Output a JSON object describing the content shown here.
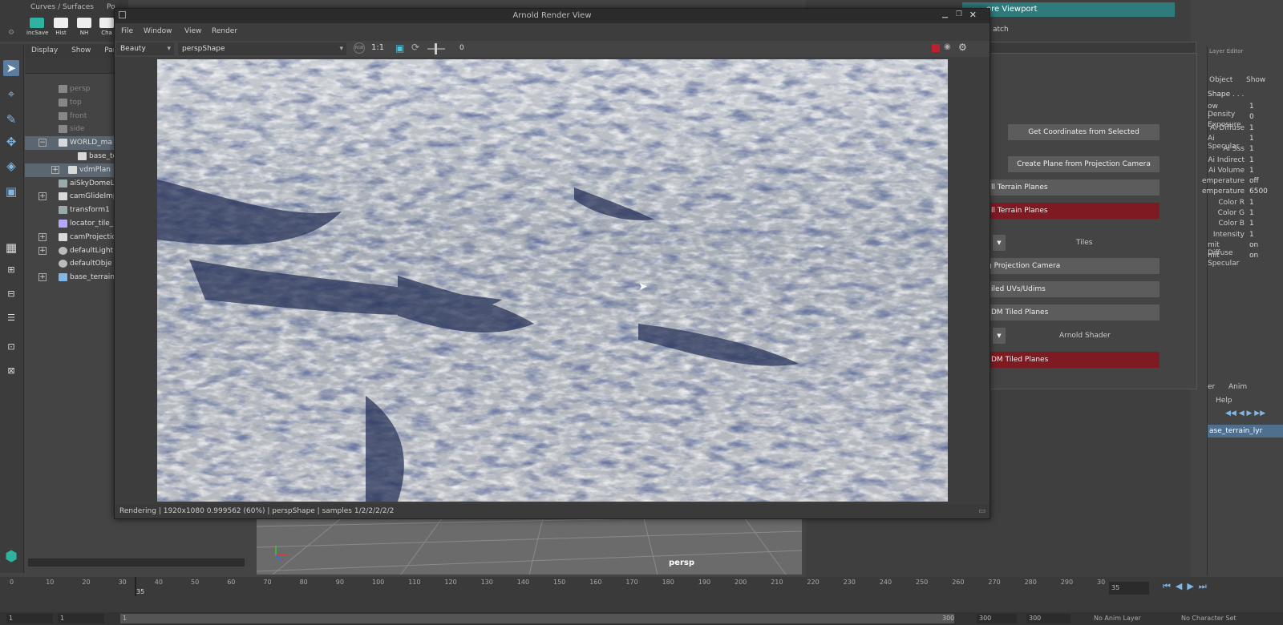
{
  "shelf": {
    "tabs": [
      "Curves / Surfaces",
      "Po"
    ],
    "buttons": [
      "incSave",
      "Hist",
      "NH",
      "Cha"
    ]
  },
  "outliner": {
    "menu": [
      "Display",
      "Show",
      "Pane"
    ],
    "items": [
      {
        "label": "persp",
        "dim": true,
        "icon": "camera"
      },
      {
        "label": "top",
        "dim": true,
        "icon": "camera"
      },
      {
        "label": "front",
        "dim": true,
        "icon": "camera"
      },
      {
        "label": "side",
        "dim": true,
        "icon": "camera"
      },
      {
        "label": "WORLD_ma",
        "dim": false,
        "icon": "group",
        "expander": "−",
        "highlight": true
      },
      {
        "label": "base_ter",
        "dim": false,
        "icon": "group-child",
        "indent": 2
      },
      {
        "label": "vdmPlan",
        "dim": false,
        "icon": "group",
        "expander": "+",
        "indent": 1,
        "highlight": true
      },
      {
        "label": "aiSkyDomeL",
        "dim": false,
        "icon": "cube"
      },
      {
        "label": "camGlideImp",
        "dim": false,
        "icon": "group",
        "expander": "+"
      },
      {
        "label": "transform1",
        "dim": false,
        "icon": "cube"
      },
      {
        "label": "locator_tile_",
        "dim": false,
        "icon": "locator"
      },
      {
        "label": "camProjectio",
        "dim": false,
        "icon": "group",
        "expander": "+"
      },
      {
        "label": "defaultLight",
        "dim": false,
        "icon": "set",
        "expander": "+"
      },
      {
        "label": "defaultObje",
        "dim": false,
        "icon": "set"
      },
      {
        "label": "base_terrain",
        "dim": false,
        "icon": "layer",
        "expander": "+"
      }
    ]
  },
  "arv": {
    "title": "Arnold Render View",
    "menu": [
      "File",
      "Window",
      "View",
      "Render"
    ],
    "aov": "Beauty",
    "camera": "perspShape",
    "ratio": "1:1",
    "exposure": "0",
    "status": "Rendering | 1920x1080 0.999562 (60%) | perspShape  | samples 1/2/2/2/2/2"
  },
  "right_panel": {
    "restore": "ore Viewport",
    "tab_fragment": "atch",
    "buttons": [
      {
        "label": "Get Coordinates from Selected",
        "red": false
      },
      {
        "label": "Create Plane from Projection Camera",
        "red": false
      },
      {
        "label": "ll Terrain Planes",
        "red": false
      },
      {
        "label": "ll Terrain Planes",
        "red": true
      },
      {
        "label": "g Projection Camera",
        "red": false
      },
      {
        "label": "iled UVs/Udims",
        "red": false
      },
      {
        "label": "DM Tiled Planes",
        "red": false
      },
      {
        "label": "DM Tiled Planes",
        "red": true
      }
    ],
    "labels": [
      "Tiles",
      "Arnold Shader"
    ]
  },
  "channel_box": {
    "header": "Layer Editor",
    "tabs": [
      "Object",
      "Show"
    ],
    "shape": "Shape . . .",
    "channels": [
      {
        "name": "ow Density",
        "value": "1"
      },
      {
        "name": "i Exposure",
        "value": "0"
      },
      {
        "name": "Ai Diffuse",
        "value": "1"
      },
      {
        "name": "Ai Specular",
        "value": "1"
      },
      {
        "name": "Ai Sss",
        "value": "1"
      },
      {
        "name": "Ai Indirect",
        "value": "1"
      },
      {
        "name": "Ai Volume",
        "value": "1"
      },
      {
        "name": "emperature",
        "value": "off"
      },
      {
        "name": "emperature",
        "value": "6500"
      },
      {
        "name": "Color R",
        "value": "1"
      },
      {
        "name": "Color G",
        "value": "1"
      },
      {
        "name": "Color B",
        "value": "1"
      },
      {
        "name": "Intensity",
        "value": "1"
      },
      {
        "name": "mit Diffuse",
        "value": "on"
      },
      {
        "name": "mit Specular",
        "value": "on"
      }
    ],
    "layer_tabs": [
      "er",
      "Anim"
    ],
    "help": "Help",
    "layer": "ase_terrain_lyr"
  },
  "viewport": {
    "label": "persp"
  },
  "timeline": {
    "ticks": [
      "0",
      "10",
      "20",
      "30",
      "40",
      "50",
      "60",
      "70",
      "80",
      "90",
      "100",
      "110",
      "120",
      "130",
      "140",
      "150",
      "160",
      "170",
      "180",
      "190",
      "200",
      "210",
      "220",
      "230",
      "240",
      "250",
      "260",
      "270",
      "280",
      "290",
      "30"
    ],
    "current_frame_label": "35",
    "current_frame_field": "35",
    "range_fields": [
      "1",
      "1",
      "1",
      "300",
      "300",
      "300"
    ],
    "anim_layer": "No Anim Layer",
    "char_set": "No Character Set"
  }
}
